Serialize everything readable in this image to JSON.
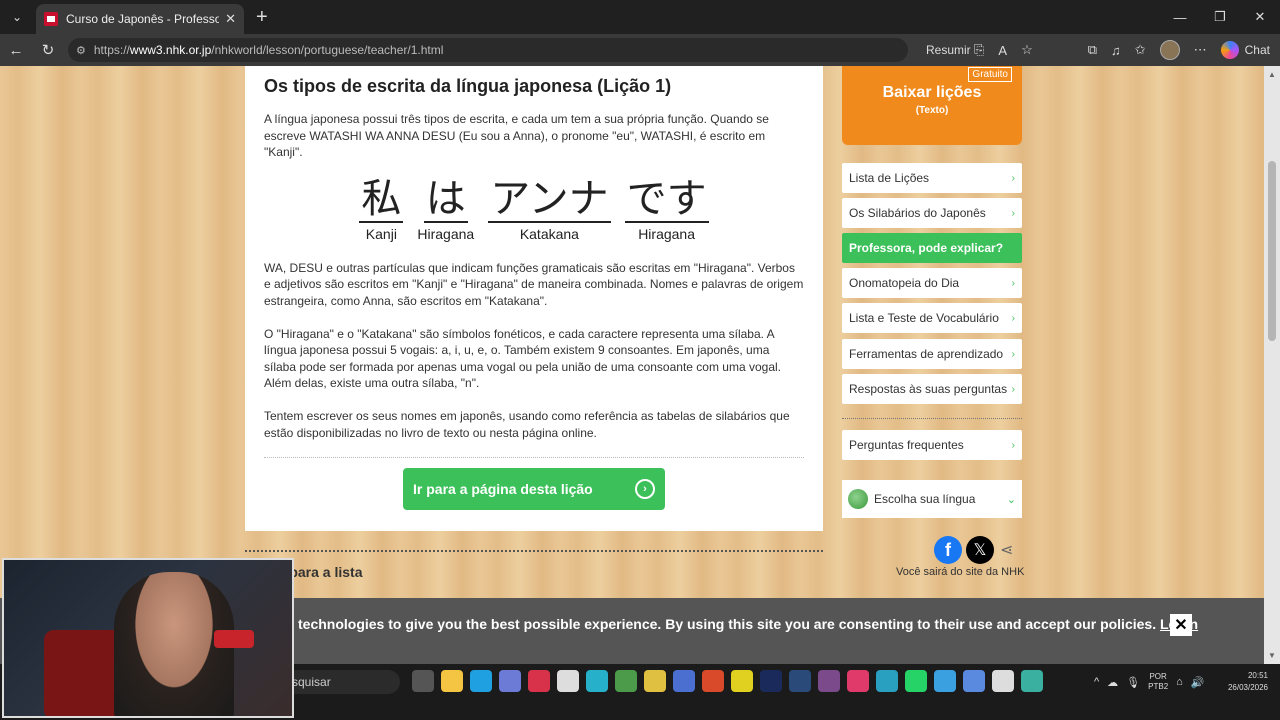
{
  "browser": {
    "tab_title": "Curso de Japonês - Professora, po",
    "url_prefix": "https://",
    "url_host": "www3.nhk.or.jp",
    "url_path": "/nhkworld/lesson/portuguese/teacher/1.html",
    "summarize_label": "Resumir",
    "chat_label": "Chat"
  },
  "article": {
    "title": "Os tipos de escrita da língua japonesa (Lição 1)",
    "para1": "A língua japonesa possui três tipos de escrita, e cada um tem a sua própria função. Quando se escreve WATASHI WA ANNA DESU (Eu sou a Anna), o pronome \"eu\", WATASHI, é escrito em \"Kanji\".",
    "words": [
      {
        "glyph": "私",
        "label": "Kanji"
      },
      {
        "glyph": "は",
        "label": "Hiragana"
      },
      {
        "glyph": "アンナ",
        "label": "Katakana"
      },
      {
        "glyph": "です",
        "label": "Hiragana"
      }
    ],
    "para2": "WA, DESU e outras partículas que indicam funções gramaticais são escritas em \"Hiragana\". Verbos e adjetivos são escritos em \"Kanji\" e \"Hiragana\" de maneira combinada. Nomes e palavras de origem estrangeira, como Anna, são escritos em \"Katakana\".",
    "para3": "O \"Hiragana\" e o \"Katakana\" são símbolos fonéticos, e cada caractere representa uma sílaba. A língua japonesa possui 5 vogais: a, i, u, e, o. Também existem 9 consoantes. Em japonês, uma sílaba pode ser formada por apenas uma vogal ou pela união de uma consoante com uma vogal. Além delas, existe uma outra sílaba, \"n\".",
    "para4": "Tentem escrever os seus nomes em japonês, usando como referência as tabelas de silabários que estão disponibilizadas no livro de texto ou nesta página online.",
    "cta_label": "Ir para a página desta lição",
    "back_label": "r para a lista"
  },
  "sidebar": {
    "download_badge": "Gratuito",
    "download_title": "Baixar lições",
    "download_sub": "(Texto)",
    "items": [
      {
        "label": "Lista de Lições"
      },
      {
        "label": "Os Silabários do Japonês"
      },
      {
        "label": "Professora, pode explicar?"
      },
      {
        "label": "Onomatopeia do Dia"
      },
      {
        "label": "Lista e Teste de Vocabulário"
      },
      {
        "label": "Ferramentas de aprendizado"
      },
      {
        "label": "Respostas às suas perguntas"
      }
    ],
    "faq_label": "Perguntas frequentes",
    "language_label": "Escolha sua língua",
    "leave_notice": "Você sairá do site da NHK"
  },
  "cookie": {
    "text": "technologies to give you the best possible experience. By using this site you are consenting to their use and accept our policies.",
    "learn_label": "Learn"
  },
  "taskbar": {
    "search_text": "squisar",
    "lang_top": "POR",
    "lang_bottom": "PTB2",
    "time": "20:51",
    "date": "26/03/2026"
  }
}
